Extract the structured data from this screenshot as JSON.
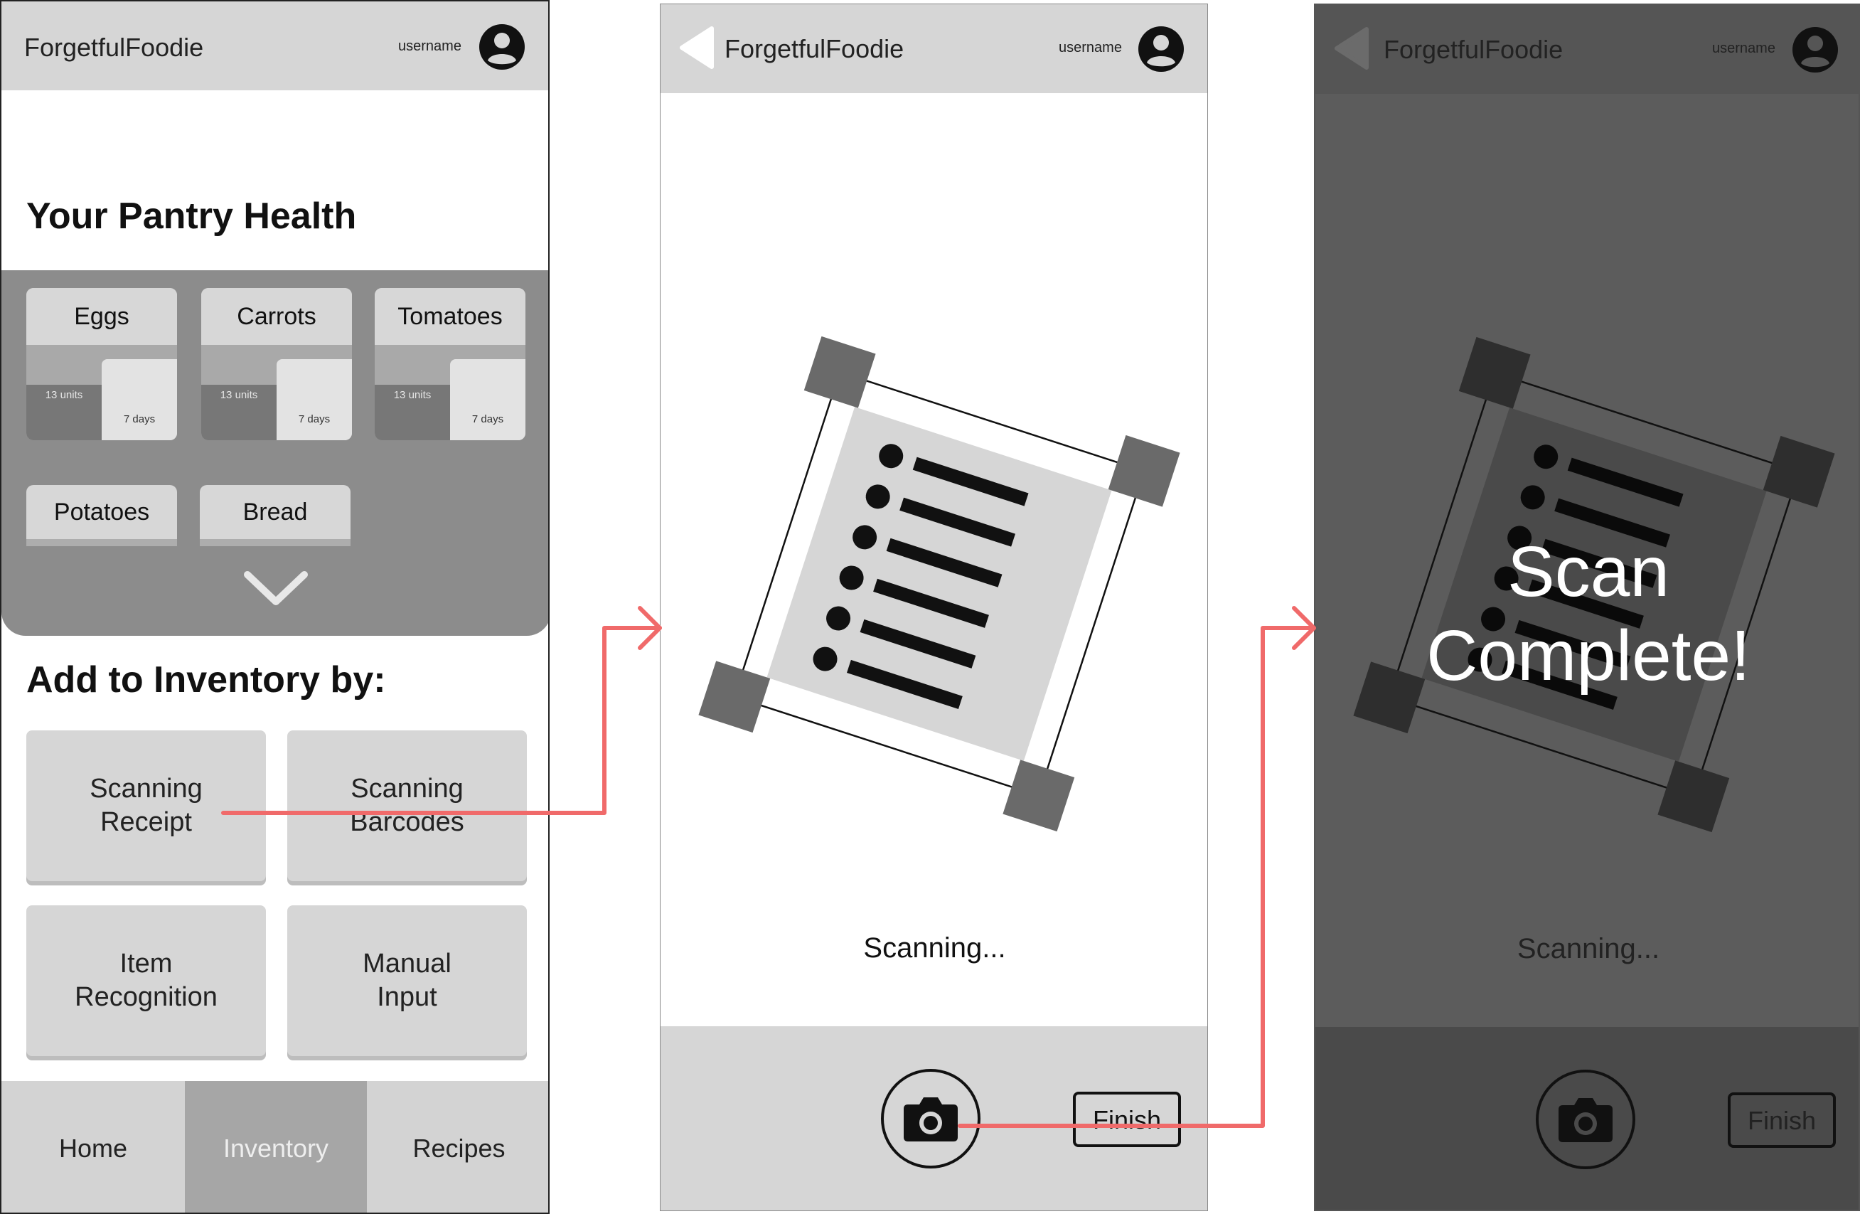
{
  "app": {
    "brand": "ForgetfulFoodie",
    "username": "username"
  },
  "screen1": {
    "pantry_title": "Your Pantry Health",
    "items": [
      {
        "name": "Eggs",
        "units": "13 units",
        "days": "7 days"
      },
      {
        "name": "Carrots",
        "units": "13 units",
        "days": "7 days"
      },
      {
        "name": "Tomatoes",
        "units": "13 units",
        "days": "7 days"
      },
      {
        "name": "Potatoes"
      },
      {
        "name": "Bread"
      }
    ],
    "add_title": "Add to Inventory by:",
    "add_buttons": [
      {
        "label": "Scanning\nReceipt"
      },
      {
        "label": "Scanning\nBarcodes"
      },
      {
        "label": "Item\nRecognition"
      },
      {
        "label": "Manual\nInput"
      }
    ],
    "nav": [
      {
        "label": "Home",
        "active": false
      },
      {
        "label": "Inventory",
        "active": true
      },
      {
        "label": "Recipes",
        "active": false
      }
    ]
  },
  "screen2": {
    "status": "Scanning...",
    "finish_label": "Finish"
  },
  "screen3": {
    "status": "Scanning...",
    "finish_label": "Finish",
    "overlay_line1": "Scan",
    "overlay_line2": "Complete!"
  },
  "colors": {
    "arrow": "#f06a6a",
    "topbar": "#d6d6d6",
    "pantry_bg": "#8c8c8c",
    "nav_active": "#a6a6a6",
    "overlay_dim": "#5c5c5c"
  }
}
